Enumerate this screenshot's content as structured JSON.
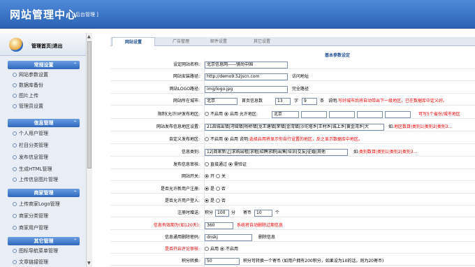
{
  "header": {
    "title": "网站管理中心",
    "subtitle": "[ 后台管理 ]"
  },
  "user": {
    "links": "管理首页|退出"
  },
  "groups": [
    {
      "title": "常规设置",
      "items": [
        "网站参数设置",
        "数据库备份",
        "图片上传",
        "管理员设置"
      ]
    },
    {
      "title": "信息管理",
      "items": [
        "个人用户管理",
        "栏目分类管理",
        "发布信息管理",
        "生成HTML管理",
        "上传信息图片管理"
      ]
    },
    {
      "title": "商家管理",
      "items": [
        "上传商家Logo管理",
        "商家分类管理",
        "商家用户管理"
      ]
    },
    {
      "title": "其它管理",
      "items": [
        "图标导航菜单管理",
        "文章链接管理"
      ]
    }
  ],
  "tabs": [
    "网站设置",
    "广告管理",
    "邮件设置",
    "其它设置"
  ],
  "caption": "基本参数设定",
  "form": {
    "site_name": {
      "label": "设定网站名称:",
      "value": "北京信息网——镜尚中国"
    },
    "site_url": {
      "label": "网站安装路径:",
      "value": "http://demo9.52jscn.com",
      "note": "访问地址"
    },
    "logo": {
      "label": "网站LOGO路径:",
      "value": "img/logo.jpg",
      "note": "完全路径"
    },
    "city": {
      "label": "网站所在城市:",
      "value": "北京",
      "home_label": "首页信息数",
      "home_v1": "13",
      "unit1": "字",
      "home_v2": "9",
      "unit2": "条",
      "note_prefix": "说明:",
      "note": "写好城市后将自动带出下一级地区，已在数据库中定义好。"
    },
    "limit_area": {
      "label": "限制(允许)IP发布地区:",
      "opt1": "不启用",
      "opt2": "启用",
      "allow_label": "允许地区:",
      "v1": "北京",
      "note": "可写5个省份/城市地区"
    },
    "area_setting": {
      "label": "网站发布信息地区设置:",
      "value": "21昌城出镇|河缉镇|杨桥镇|龙王塘镇|荣镇|金湾镇|沙坨塔乡|王村乡|城上乡|黄金湾乡|大",
      "note_prefix": "如:",
      "note": "地区数目|类别1|类别2|类别3..."
    },
    "custom_area": {
      "label": "自定义发布地区:",
      "opt1": "不启用",
      "opt2": "启用",
      "note_prefix": "说明:",
      "note": "选择启用将显示你自行设置的地区，反之显示数据库中地区。"
    },
    "info_type": {
      "label": "信息类别:",
      "value": "12|商家新让|求购出租|求租|招聘求职|出售|培训|交友|征婚|其他",
      "note_prefix": "如:",
      "note": "类别数目|类别1|类别2|类别3..."
    },
    "audit": {
      "label": "发布信息审核:",
      "opt1": "直接通过",
      "opt2": "需验证"
    },
    "switch": {
      "label": "网站开关:",
      "opt1": "开",
      "opt2": "关"
    },
    "allow_reg": {
      "label": "是否允许新用户注册:",
      "opt1": "是",
      "opt2": "否"
    },
    "allow_login": {
      "label": "是否允许用户登入:",
      "opt1": "是",
      "opt2": "否"
    },
    "reg_gift": {
      "label": "注册时赠送:",
      "points_label": "积分",
      "points": "100",
      "unit1": "分",
      "coins_label": "寄币",
      "coins": "10",
      "unit2": "个"
    },
    "valid_days": {
      "label": "信息有效期为(如120天):",
      "value": "360",
      "note": "系统将自动删除过期信息"
    },
    "delete_pwd": {
      "label": "信息通用删除密码:",
      "value": "dnskj",
      "note": "删除信息"
    },
    "comment_audit": {
      "label": "是否开启评论审核:",
      "opt1": "启用",
      "opt2": "不启用"
    },
    "exchange": {
      "label": "积分转换:",
      "value": "50",
      "note": "积分可转换一个寄币 (如用户拥有200积分，如果设为10的话，则为20寄币)"
    }
  }
}
